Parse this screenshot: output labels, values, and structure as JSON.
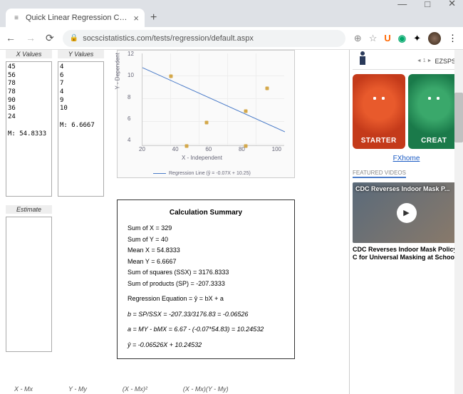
{
  "browser": {
    "tab_title": "Quick Linear Regression Calculat",
    "url": "socscistatistics.com/tests/regression/default.aspx",
    "window_controls": {
      "min": "—",
      "max": "□",
      "close": "✕"
    }
  },
  "inputs": {
    "x_label": "X Values",
    "y_label": "Y Values",
    "x_values": "45\n56\n78\n78\n90\n36\n24\n\nM: 54.8333",
    "y_values": "4\n6\n7\n4\n9\n10\n\nM: 6.6667",
    "estimate_label": "Estimate"
  },
  "chart_data": {
    "type": "scatter",
    "title": "",
    "xlabel": "X - Independent",
    "ylabel": "Y - Dependent",
    "xlim": [
      20,
      100
    ],
    "ylim": [
      4,
      12
    ],
    "xticks": [
      20,
      40,
      60,
      80,
      100
    ],
    "yticks": [
      4,
      6,
      8,
      10,
      12
    ],
    "points": [
      {
        "x": 45,
        "y": 4
      },
      {
        "x": 56,
        "y": 6
      },
      {
        "x": 78,
        "y": 7
      },
      {
        "x": 78,
        "y": 4
      },
      {
        "x": 90,
        "y": 9
      },
      {
        "x": 36,
        "y": 10
      }
    ],
    "regression": {
      "slope": -0.07,
      "intercept": 10.25,
      "label": "Regression Line (ŷ = -0.07X + 10.25)"
    }
  },
  "summary": {
    "title": "Calculation Summary",
    "lines": {
      "sumx": "Sum of X = 329",
      "sumy": "Sum of Y = 40",
      "meanx": "Mean X = 54.8333",
      "meany": "Mean Y = 6.6667",
      "ssx": "Sum of squares (SSX) = 3176.8333",
      "sp": "Sum of products (SP) = -207.3333",
      "eq_label": "Regression Equation = ŷ = bX + a",
      "b": "b = SP/SSX = -207.33/3176.83 = -0.06526",
      "a": "a = MY - bMX = 6.67 - (-0.07*54.83) = 10.24532",
      "final": "ŷ = -0.06526X + 10.24532"
    }
  },
  "bottom_headers": [
    "X - Mx",
    "Y - My",
    "(X - Mx)²",
    "(X - Mx)(Y - My)"
  ],
  "sidebar": {
    "ez": "EZSPS",
    "indicator": "◄ 1 ►",
    "mascot1": "STARTER",
    "mascot2": "CREAT",
    "fxhome": "FXhome",
    "featured": "FEATURED VIDEOS",
    "video_overlay": "CDC Reverses Indoor Mask P...",
    "video_caption": "CDC Reverses Indoor Mask Policy, C for Universal Masking at Schools"
  }
}
